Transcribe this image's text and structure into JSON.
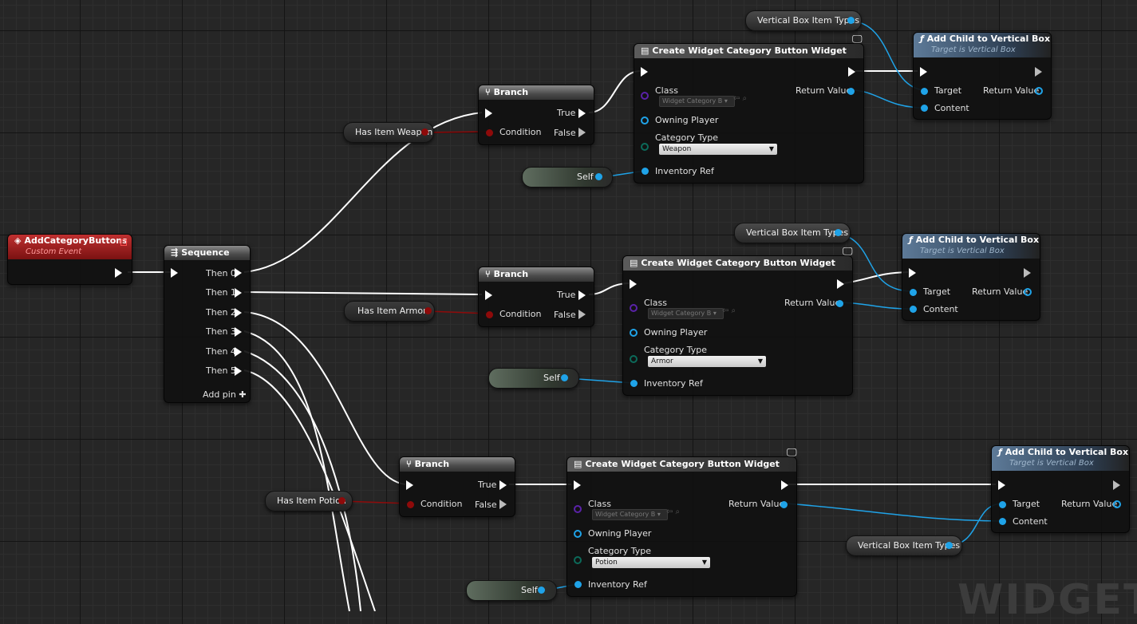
{
  "watermark": "WIDGET",
  "event_node": {
    "title": "AddCategoryButtons",
    "subtitle": "Custom Event"
  },
  "sequence_node": {
    "title": "Sequence",
    "outputs": [
      "Then 0",
      "Then 1",
      "Then 2",
      "Then 3",
      "Then 4",
      "Then 5"
    ],
    "add_pin": "Add pin"
  },
  "branches": [
    {
      "title": "Branch",
      "condition": "Condition",
      "true": "True",
      "false": "False",
      "variable": "Has Item Weapon"
    },
    {
      "title": "Branch",
      "condition": "Condition",
      "true": "True",
      "false": "False",
      "variable": "Has Item Armor"
    },
    {
      "title": "Branch",
      "condition": "Condition",
      "true": "True",
      "false": "False",
      "variable": "Has Item Potion"
    }
  ],
  "create_widgets": [
    {
      "title": "Create Widget Category Button Widget",
      "class_label": "Class",
      "class_value": "Widget Category B",
      "owning_player": "Owning Player",
      "category_type_label": "Category Type",
      "category_type": "Weapon",
      "inventory_ref": "Inventory Ref",
      "return_value": "Return Value",
      "self_label": "Self"
    },
    {
      "title": "Create Widget Category Button Widget",
      "class_label": "Class",
      "class_value": "Widget Category B",
      "owning_player": "Owning Player",
      "category_type_label": "Category Type",
      "category_type": "Armor",
      "inventory_ref": "Inventory Ref",
      "return_value": "Return Value",
      "self_label": "Self"
    },
    {
      "title": "Create Widget Category Button Widget",
      "class_label": "Class",
      "class_value": "Widget Category B",
      "owning_player": "Owning Player",
      "category_type_label": "Category Type",
      "category_type": "Potion",
      "inventory_ref": "Inventory Ref",
      "return_value": "Return Value",
      "self_label": "Self"
    }
  ],
  "add_child_nodes": [
    {
      "title": "Add Child to Vertical Box",
      "subtitle": "Target is Vertical Box",
      "target": "Target",
      "content": "Content",
      "return_value": "Return Value",
      "variable": "Vertical Box Item Types"
    },
    {
      "title": "Add Child to Vertical Box",
      "subtitle": "Target is Vertical Box",
      "target": "Target",
      "content": "Content",
      "return_value": "Return Value",
      "variable": "Vertical Box Item Types"
    },
    {
      "title": "Add Child to Vertical Box",
      "subtitle": "Target is Vertical Box",
      "target": "Target",
      "content": "Content",
      "return_value": "Return Value",
      "variable": "Vertical Box Item Types"
    }
  ],
  "colors": {
    "exec_wire": "#ffffff",
    "object_wire": "#1fa3e8",
    "bool_wire": "#8e0a0a",
    "event_header": "#a51d1d",
    "function_header": "#3e5670"
  }
}
